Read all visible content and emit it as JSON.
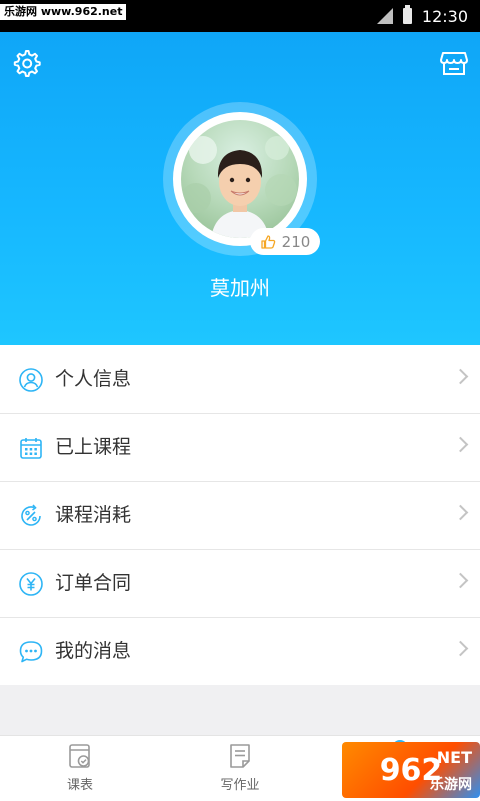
{
  "status_bar": {
    "watermark": "乐游网 www.962.net",
    "time": "12:30"
  },
  "profile": {
    "likes": "210",
    "name": "莫加州"
  },
  "menu": {
    "items": [
      {
        "label": "个人信息",
        "icon": "person-icon"
      },
      {
        "label": "已上课程",
        "icon": "calendar-icon"
      },
      {
        "label": "课程消耗",
        "icon": "percent-refresh-icon"
      },
      {
        "label": "订单合同",
        "icon": "yuan-icon"
      },
      {
        "label": "我的消息",
        "icon": "chat-icon"
      }
    ]
  },
  "tabbar": {
    "tabs": [
      {
        "label": "课表"
      },
      {
        "label": "写作业"
      }
    ]
  },
  "watermark_bottom": {
    "logo": "962",
    "net": ".NET",
    "cn": "乐游网"
  },
  "colors": {
    "accent": "#14b4ff",
    "icon_blue": "#2eb5f5"
  }
}
